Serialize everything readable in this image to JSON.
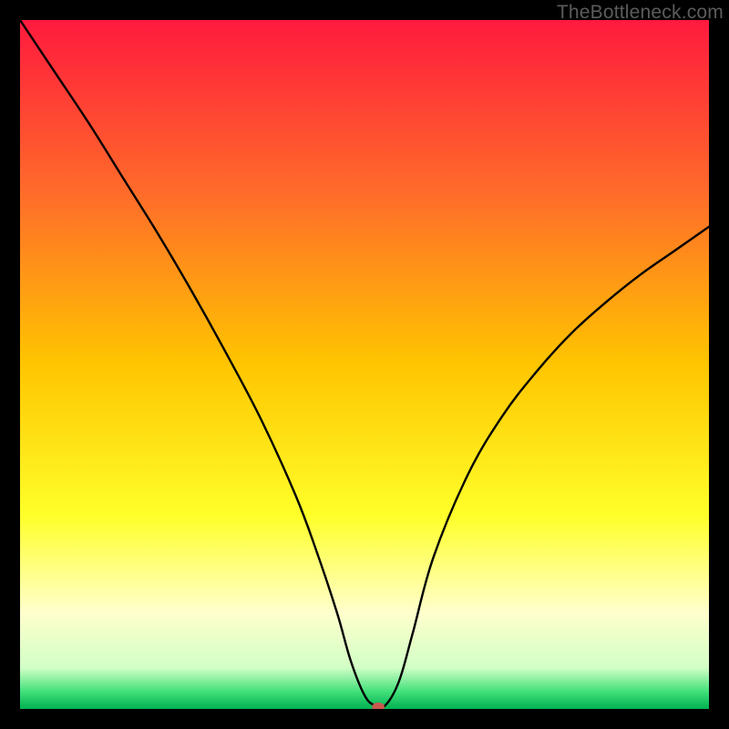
{
  "watermark": "TheBottleneck.com",
  "chart_data": {
    "type": "line",
    "title": "",
    "xlabel": "",
    "ylabel": "",
    "xlim": [
      0,
      100
    ],
    "ylim": [
      0,
      100
    ],
    "grid": false,
    "legend": false,
    "background_gradient": {
      "stops": [
        {
          "pos": 0.0,
          "color": "#ff1a3e"
        },
        {
          "pos": 0.25,
          "color": "#ff6b2a"
        },
        {
          "pos": 0.5,
          "color": "#ffc500"
        },
        {
          "pos": 0.72,
          "color": "#ffff2a"
        },
        {
          "pos": 0.86,
          "color": "#ffffcc"
        },
        {
          "pos": 0.94,
          "color": "#d2ffc6"
        },
        {
          "pos": 0.975,
          "color": "#41e07a"
        },
        {
          "pos": 1.0,
          "color": "#00b050"
        }
      ]
    },
    "series": [
      {
        "name": "bottleneck-curve",
        "color": "#000000",
        "x": [
          0,
          5,
          10,
          15,
          20,
          25,
          30,
          35,
          40,
          43,
          46,
          48,
          50,
          51.5,
          53,
          55,
          57,
          60,
          65,
          70,
          75,
          80,
          85,
          90,
          95,
          100
        ],
        "y": [
          100,
          92.5,
          85,
          77,
          69,
          60.5,
          51.5,
          42,
          31,
          23,
          14,
          7,
          2,
          0.5,
          0.5,
          4,
          11,
          22,
          34,
          42.5,
          49,
          54.5,
          59,
          63,
          66.5,
          70
        ]
      }
    ],
    "marker": {
      "name": "optimum-point",
      "x": 52,
      "y": 0.3,
      "color": "#c7594e",
      "rx": 0.9,
      "ry": 0.65
    }
  }
}
